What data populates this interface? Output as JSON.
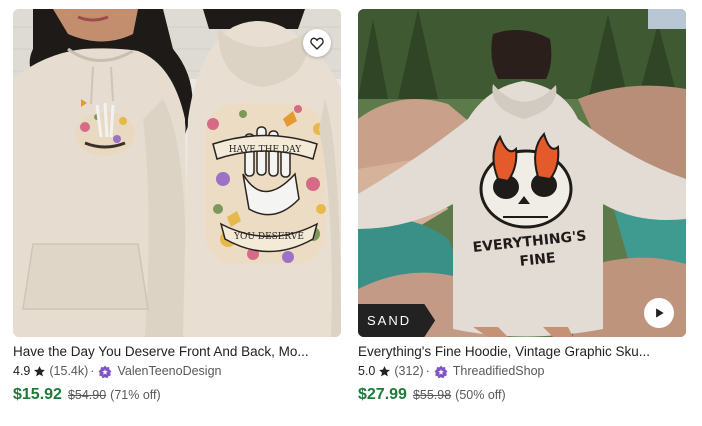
{
  "listings": [
    {
      "title": "Have the Day You Deserve Front And Back, Mo...",
      "rating": "4.9",
      "reviews": "(15.4k)",
      "separator": "·",
      "shop": "ValenTeenoDesign",
      "price": "$15.92",
      "original_price": "$54.90",
      "discount": "(71% off)",
      "print_top": "HAVE THE DAY",
      "print_bottom": "YOU DESERVE",
      "icons": [
        "heart-icon",
        "star-icon",
        "star-seller-badge-icon"
      ]
    },
    {
      "title": "Everything's Fine Hoodie, Vintage Graphic Sku...",
      "rating": "5.0",
      "reviews": "(312)",
      "separator": "·",
      "shop": "ThreadifiedShop",
      "price": "$27.99",
      "original_price": "$55.98",
      "discount": "(50% off)",
      "badge": "SAND",
      "print_text_1": "EVERYTHING'S",
      "print_text_2": "FINE",
      "icons": [
        "star-icon",
        "star-seller-badge-icon",
        "play-icon"
      ]
    }
  ],
  "colors": {
    "price_green": "#1d7a3a",
    "star_seller_purple": "#7f54c8",
    "hoodie_sand": "#e6ddd0"
  }
}
